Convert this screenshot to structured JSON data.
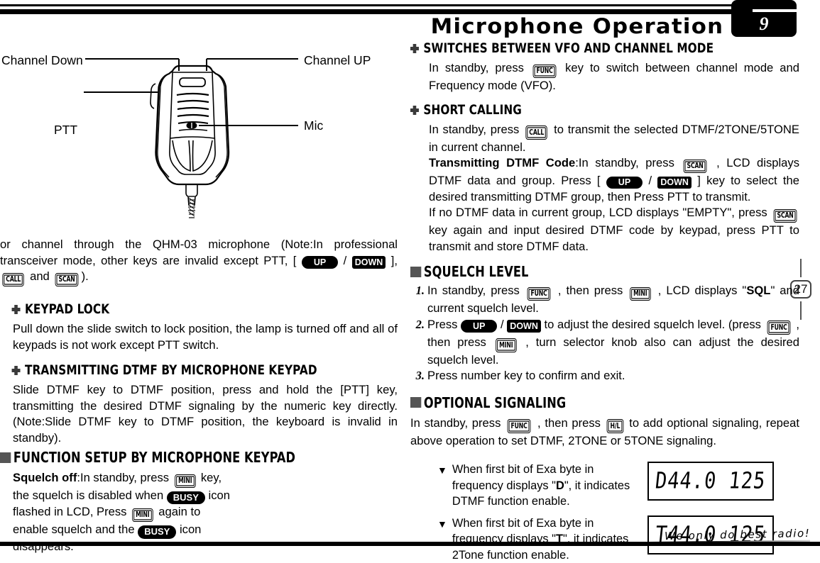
{
  "header": {
    "title": "Microphone Operation",
    "chapter_number": "9"
  },
  "page_marker": {
    "number": "27"
  },
  "footer": {
    "slogan": "We only do best radio!"
  },
  "figure": {
    "name": "microphone-diagram",
    "labels": {
      "channel_down": "Channel Down",
      "ptt": "PTT",
      "channel_up": "Channel UP",
      "mic": "Mic"
    }
  },
  "keys": {
    "func": "FUNC",
    "call": "CALL",
    "scan": "SCAN",
    "mini": "MINI",
    "hl": "H/L",
    "up": "UP",
    "down": "DOWN",
    "busy": "BUSY"
  },
  "left_column": {
    "continued_paragraph": {
      "part1": "or channel through the QHM-03 microphone (Note:In professional transceiver mode, other keys are invalid except PTT, [ ",
      "part2": " / ",
      "part3": " ], ",
      "part4": " and ",
      "part5": ")."
    },
    "sections": [
      {
        "id": "keypad-lock",
        "heading": "KEYPAD LOCK",
        "bullet": "cross-bullet-icon",
        "body": "Pull down the slide switch to lock position, the lamp is turned off and all of keypads is not work except PTT switch."
      },
      {
        "id": "transmitting-dtmf",
        "heading": "TRANSMITTING DTMF BY MICROPHONE KEYPAD",
        "bullet": "cross-bullet-icon",
        "body": "Slide DTMF key to DTMF position, press and hold the [PTT] key, transmitting the desired DTMF signaling by the numeric key directly. (Note:Slide DTMF key to DTMF position, the keyboard is invalid in standby)."
      },
      {
        "id": "function-setup",
        "heading": "FUNCTION SETUP BY MICROPHONE KEYPAD",
        "bullet": "square-bullet-icon",
        "squelch_off": {
          "label": "Squelch off",
          "t1": ":In standby, press ",
          "t2": " key, the squelch is disabled when ",
          "t3": " icon flashed in LCD, Press ",
          "t4": " again to enable squelch and the ",
          "t5": " icon disappears."
        }
      }
    ]
  },
  "right_column": {
    "sections": [
      {
        "id": "switches-vfo-channel",
        "heading": "SWITCHES BETWEEN VFO AND CHANNEL MODE",
        "bullet": "cross-bullet-icon",
        "t1": "In standby, press ",
        "t2": " key to switch between channel mode and Frequency mode (VFO)."
      },
      {
        "id": "short-calling",
        "heading": "SHORT CALLING",
        "bullet": "cross-bullet-icon",
        "p1_a": "In standby, press ",
        "p1_b": " to transmit the selected DTMF/2TONE/5TONE in current channel.",
        "p2_label": "Transmitting DTMF Code",
        "p2_a": ":In standby, press ",
        "p2_b": " , LCD displays DTMF data and group. Press [ ",
        "p2_c": " / ",
        "p2_d": " ] key to select the desired transmitting  DTMF group, then Press PTT to transmit.",
        "p3_a": "If no DTMF data in current group, LCD displays \"EMPTY\", press ",
        "p3_b": " key again and input desired DTMF code by keypad, press PTT to transmit and store DTMF data."
      },
      {
        "id": "squelch-level",
        "heading": "SQUELCH LEVEL",
        "bullet": "square-bullet-icon",
        "items": [
          {
            "num": "1.",
            "a": "In standby, press ",
            "b": " , then press ",
            "c": " , LCD displays \"",
            "sql": "SQL",
            "d": "\" and current squelch level."
          },
          {
            "num": "2.",
            "a": "Press ",
            "b": " / ",
            "c": " to adjust the desired squelch level. (press ",
            "d": " , then press ",
            "e": " , turn selector knob also can adjust the desired squelch level."
          },
          {
            "num": "3.",
            "a": "Press number key to confirm and exit."
          }
        ]
      },
      {
        "id": "optional-signaling",
        "heading": "OPTIONAL SIGNALING",
        "bullet": "square-bullet-icon",
        "p_a": "In standby, press ",
        "p_b": " , then press ",
        "p_c": " to add optional signaling, repeat above operation to set DTMF, 2TONE or 5TONE signaling.",
        "notes": [
          {
            "marker": "▼",
            "a": "When first bit of Exa byte in frequency displays \"",
            "bold": "D",
            "b": "\", it indicates DTMF function enable.",
            "lcd": "D44.0 125"
          },
          {
            "marker": "▼",
            "a": "When first bit of Exa byte in frequency displays \"",
            "bold": "T",
            "b": "\", it indicates 2Tone function enable.",
            "lcd": "T44.0 125"
          }
        ]
      }
    ]
  }
}
